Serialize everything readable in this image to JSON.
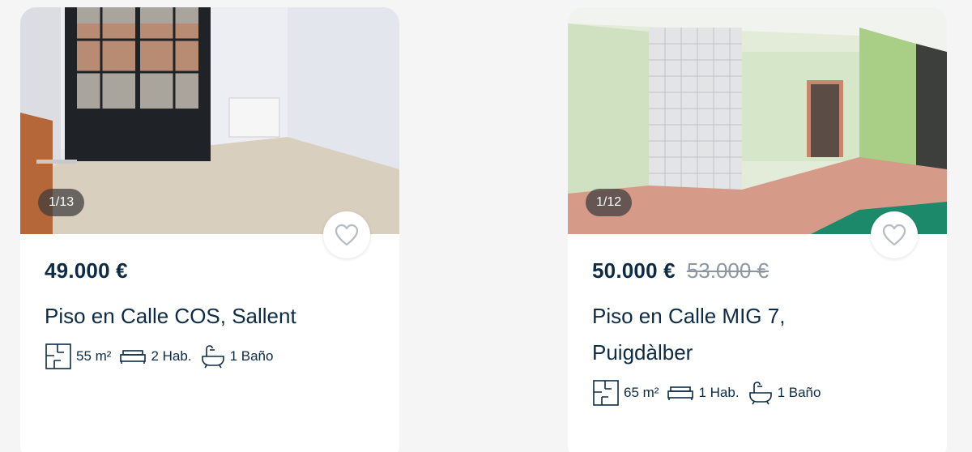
{
  "listings": [
    {
      "photo_counter": "1/13",
      "price": "49.000 €",
      "old_price": "",
      "title": "Piso en Calle COS, Sallent",
      "area": "55 m²",
      "rooms": "2 Hab.",
      "baths": "1 Baño"
    },
    {
      "photo_counter": "1/12",
      "price": "50.000 €",
      "old_price": "53.000 €",
      "title": "Piso en Calle MIG 7, Puigdàlber",
      "area": "65 m²",
      "rooms": "1 Hab.",
      "baths": "1 Baño"
    }
  ],
  "icons": {
    "favorite": "heart-outline-icon",
    "area": "floorplan-icon",
    "rooms": "bed-icon",
    "baths": "bathtub-icon"
  }
}
